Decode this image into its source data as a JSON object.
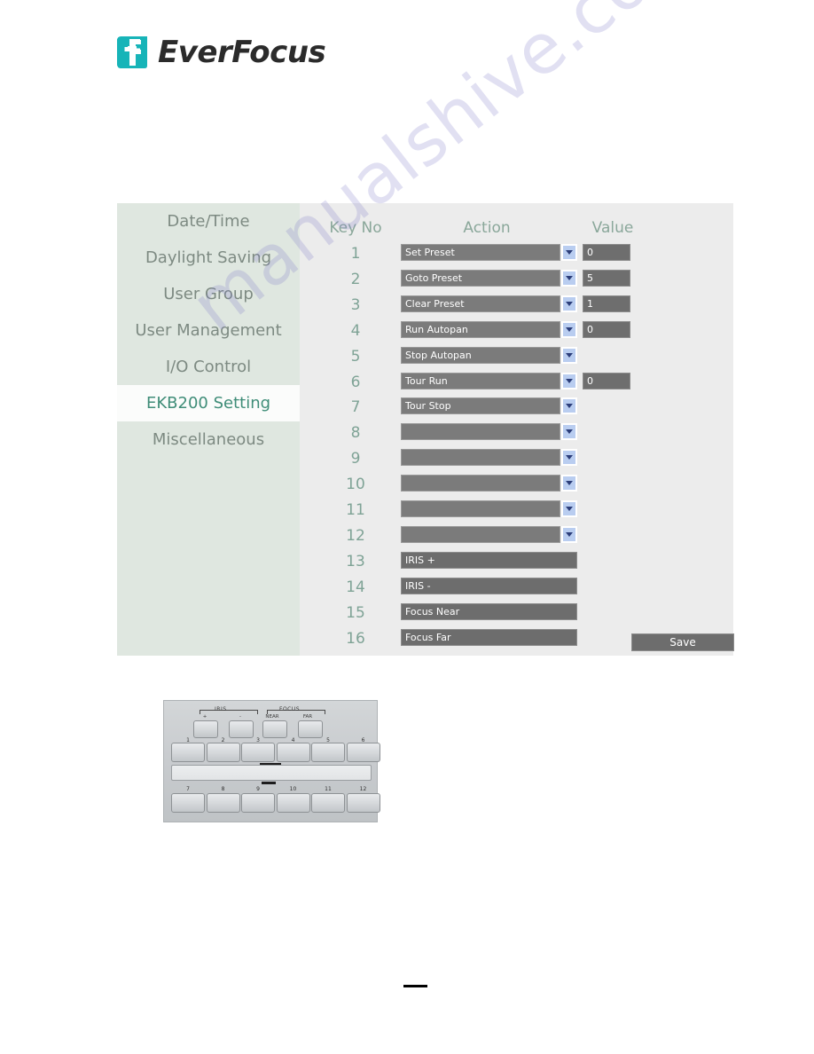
{
  "brand": {
    "name": "EverFocus",
    "logo_icon": "everfocus-logo-icon",
    "logo_color": "#17b4b8"
  },
  "watermark": {
    "text": "manualshive.com"
  },
  "sidebar": {
    "items": [
      {
        "label": "Date/Time",
        "selected": false
      },
      {
        "label": "Daylight Saving",
        "selected": false
      },
      {
        "label": "User Group",
        "selected": false
      },
      {
        "label": "User Management",
        "selected": false
      },
      {
        "label": "I/O Control",
        "selected": false
      },
      {
        "label": "EKB200 Setting",
        "selected": true
      },
      {
        "label": "Miscellaneous",
        "selected": false
      }
    ],
    "selected_color": "#3f8d78",
    "background": "#dfe7e0"
  },
  "main": {
    "headers": {
      "key_no": "Key No",
      "action": "Action",
      "value": "Value"
    },
    "rows": [
      {
        "key": "1",
        "action": "Set Preset",
        "value": "0",
        "type": "select",
        "has_value": true
      },
      {
        "key": "2",
        "action": "Goto Preset",
        "value": "5",
        "type": "select",
        "has_value": true
      },
      {
        "key": "3",
        "action": "Clear Preset",
        "value": "1",
        "type": "select",
        "has_value": true
      },
      {
        "key": "4",
        "action": "Run Autopan",
        "value": "0",
        "type": "select",
        "has_value": true
      },
      {
        "key": "5",
        "action": "Stop Autopan",
        "value": "",
        "type": "select",
        "has_value": false
      },
      {
        "key": "6",
        "action": "Tour Run",
        "value": "0",
        "type": "select",
        "has_value": true
      },
      {
        "key": "7",
        "action": "Tour Stop",
        "value": "",
        "type": "select",
        "has_value": false
      },
      {
        "key": "8",
        "action": "",
        "value": "",
        "type": "select",
        "has_value": false
      },
      {
        "key": "9",
        "action": "",
        "value": "",
        "type": "select",
        "has_value": false
      },
      {
        "key": "10",
        "action": "",
        "value": "",
        "type": "select",
        "has_value": false
      },
      {
        "key": "11",
        "action": "",
        "value": "",
        "type": "select",
        "has_value": false
      },
      {
        "key": "12",
        "action": "",
        "value": "",
        "type": "select",
        "has_value": false
      },
      {
        "key": "13",
        "action": "IRIS +",
        "value": "",
        "type": "fixed",
        "has_value": false
      },
      {
        "key": "14",
        "action": "IRIS -",
        "value": "",
        "type": "fixed",
        "has_value": false
      },
      {
        "key": "15",
        "action": "Focus Near",
        "value": "",
        "type": "fixed",
        "has_value": false
      },
      {
        "key": "16",
        "action": "Focus Far",
        "value": "",
        "type": "fixed",
        "has_value": false
      }
    ],
    "save_label": "Save"
  },
  "keypad": {
    "groups": [
      {
        "label": "IRIS",
        "keys": [
          "+",
          "-"
        ]
      },
      {
        "label": "FOCUS",
        "keys": [
          "NEAR",
          "FAR"
        ]
      }
    ],
    "row_top": [
      "1",
      "2",
      "3",
      "4",
      "5",
      "6"
    ],
    "row_bottom": [
      "7",
      "8",
      "9",
      "10",
      "11",
      "12"
    ]
  }
}
